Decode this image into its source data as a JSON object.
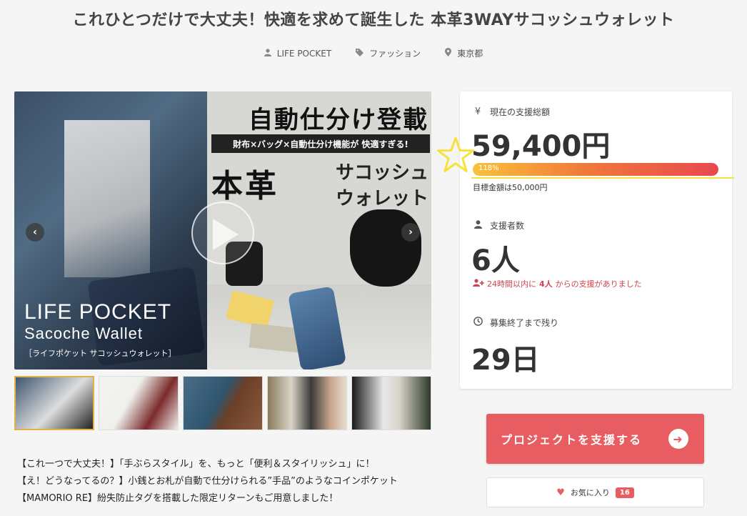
{
  "title": "これひとつだけで大丈夫！快適を求めて誕生した 本革3WAYサコッシュウォレット",
  "meta": [
    {
      "icon": "user-icon",
      "label": "LIFE POCKET"
    },
    {
      "icon": "tag-icon",
      "label": "ファッション"
    },
    {
      "icon": "location-pin-icon",
      "label": "東京都"
    }
  ],
  "hero": {
    "heading": "自動仕分け登載",
    "band": "財布×バッグ×自動仕分け機能が 快適すぎる!",
    "big": "本革",
    "sub_line1": "サコッシュ",
    "sub_line2": "ウォレット",
    "brand": "LIFE POCKET",
    "brand_sub": "Sacoche Wallet",
    "brand_jp": "［ライフポケット サコッシュウォレット］"
  },
  "thumbnails_count": 5,
  "description": [
    "【これ一つで大丈夫！】「手ぶらスタイル」を、もっと「便利＆スタイリッシュ」に！",
    "【え！どうなってるの？】小銭とお札が自動で仕分けられる”手品”のようなコインポケット",
    "【MAMORIO RE】紛失防止タグを搭載した限定リターンもご用意しました！"
  ],
  "stats": {
    "total_label": "現在の支援総額",
    "total_value": "59,400円",
    "progress_text": "118%",
    "progress_fraction": 1.0,
    "goal_text": "目標金額は50,000円",
    "backers_label": "支援者数",
    "backers_value": "6人",
    "recent_pre": "24時間以内に",
    "recent_num": "4人",
    "recent_post": "からの支援がありました",
    "remaining_label": "募集終了まで残り",
    "remaining_value": "29日"
  },
  "support_button": "プロジェクトを支援する",
  "favorite": {
    "label": "お気に入り",
    "count": "16"
  },
  "colors": {
    "accent": "#e85d61",
    "highlight": "#f6e23a"
  }
}
